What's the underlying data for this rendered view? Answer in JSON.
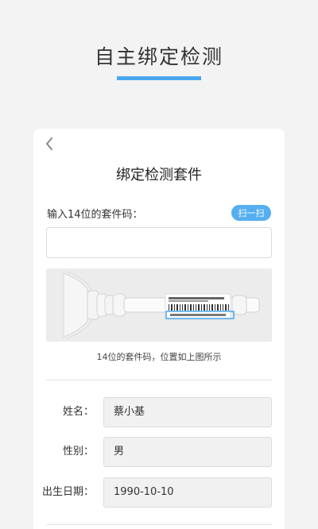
{
  "header": {
    "title": "自主绑定检测"
  },
  "card": {
    "title": "绑定检测套件",
    "kit_code_label": "输入14位的套件码：",
    "scan_button_label": "扫一扫",
    "kit_code_value": "",
    "kit_code_placeholder": "",
    "image_caption": "14位的套件码，位置如上图所示"
  },
  "form": {
    "name_label": "姓名：",
    "name_value": "蔡小基",
    "gender_label": "性别：",
    "gender_value": "男",
    "birth_label": "出生日期：",
    "birth_value": "1990-10-10"
  },
  "colors": {
    "accent": "#4aa8ee",
    "background": "#f3f3f3",
    "card": "#ffffff"
  },
  "icons": {
    "back": "chevron-left-icon"
  }
}
